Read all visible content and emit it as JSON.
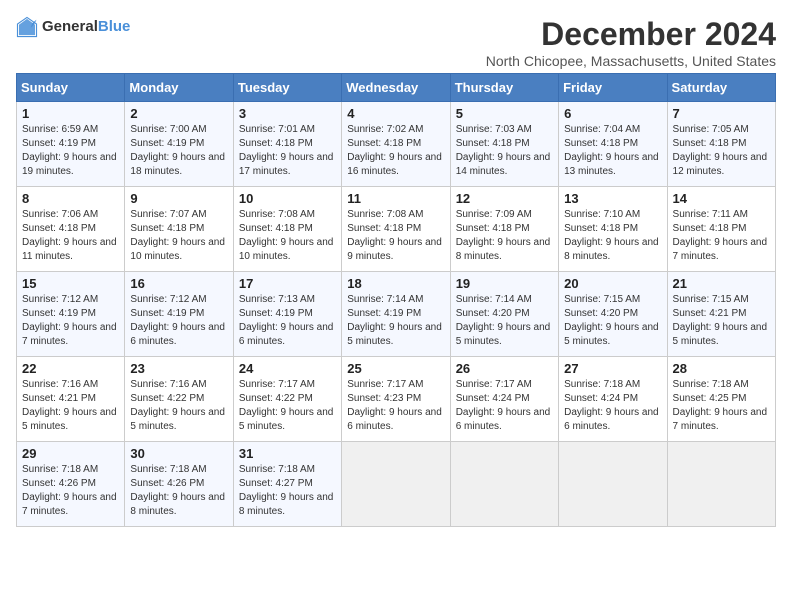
{
  "header": {
    "logo_general": "General",
    "logo_blue": "Blue",
    "title": "December 2024",
    "location": "North Chicopee, Massachusetts, United States"
  },
  "days_of_week": [
    "Sunday",
    "Monday",
    "Tuesday",
    "Wednesday",
    "Thursday",
    "Friday",
    "Saturday"
  ],
  "weeks": [
    [
      {
        "day": "1",
        "sunrise": "6:59 AM",
        "sunset": "4:19 PM",
        "daylight": "9 hours and 19 minutes."
      },
      {
        "day": "2",
        "sunrise": "7:00 AM",
        "sunset": "4:19 PM",
        "daylight": "9 hours and 18 minutes."
      },
      {
        "day": "3",
        "sunrise": "7:01 AM",
        "sunset": "4:18 PM",
        "daylight": "9 hours and 17 minutes."
      },
      {
        "day": "4",
        "sunrise": "7:02 AM",
        "sunset": "4:18 PM",
        "daylight": "9 hours and 16 minutes."
      },
      {
        "day": "5",
        "sunrise": "7:03 AM",
        "sunset": "4:18 PM",
        "daylight": "9 hours and 14 minutes."
      },
      {
        "day": "6",
        "sunrise": "7:04 AM",
        "sunset": "4:18 PM",
        "daylight": "9 hours and 13 minutes."
      },
      {
        "day": "7",
        "sunrise": "7:05 AM",
        "sunset": "4:18 PM",
        "daylight": "9 hours and 12 minutes."
      }
    ],
    [
      {
        "day": "8",
        "sunrise": "7:06 AM",
        "sunset": "4:18 PM",
        "daylight": "9 hours and 11 minutes."
      },
      {
        "day": "9",
        "sunrise": "7:07 AM",
        "sunset": "4:18 PM",
        "daylight": "9 hours and 10 minutes."
      },
      {
        "day": "10",
        "sunrise": "7:08 AM",
        "sunset": "4:18 PM",
        "daylight": "9 hours and 10 minutes."
      },
      {
        "day": "11",
        "sunrise": "7:08 AM",
        "sunset": "4:18 PM",
        "daylight": "9 hours and 9 minutes."
      },
      {
        "day": "12",
        "sunrise": "7:09 AM",
        "sunset": "4:18 PM",
        "daylight": "9 hours and 8 minutes."
      },
      {
        "day": "13",
        "sunrise": "7:10 AM",
        "sunset": "4:18 PM",
        "daylight": "9 hours and 8 minutes."
      },
      {
        "day": "14",
        "sunrise": "7:11 AM",
        "sunset": "4:18 PM",
        "daylight": "9 hours and 7 minutes."
      }
    ],
    [
      {
        "day": "15",
        "sunrise": "7:12 AM",
        "sunset": "4:19 PM",
        "daylight": "9 hours and 7 minutes."
      },
      {
        "day": "16",
        "sunrise": "7:12 AM",
        "sunset": "4:19 PM",
        "daylight": "9 hours and 6 minutes."
      },
      {
        "day": "17",
        "sunrise": "7:13 AM",
        "sunset": "4:19 PM",
        "daylight": "9 hours and 6 minutes."
      },
      {
        "day": "18",
        "sunrise": "7:14 AM",
        "sunset": "4:19 PM",
        "daylight": "9 hours and 5 minutes."
      },
      {
        "day": "19",
        "sunrise": "7:14 AM",
        "sunset": "4:20 PM",
        "daylight": "9 hours and 5 minutes."
      },
      {
        "day": "20",
        "sunrise": "7:15 AM",
        "sunset": "4:20 PM",
        "daylight": "9 hours and 5 minutes."
      },
      {
        "day": "21",
        "sunrise": "7:15 AM",
        "sunset": "4:21 PM",
        "daylight": "9 hours and 5 minutes."
      }
    ],
    [
      {
        "day": "22",
        "sunrise": "7:16 AM",
        "sunset": "4:21 PM",
        "daylight": "9 hours and 5 minutes."
      },
      {
        "day": "23",
        "sunrise": "7:16 AM",
        "sunset": "4:22 PM",
        "daylight": "9 hours and 5 minutes."
      },
      {
        "day": "24",
        "sunrise": "7:17 AM",
        "sunset": "4:22 PM",
        "daylight": "9 hours and 5 minutes."
      },
      {
        "day": "25",
        "sunrise": "7:17 AM",
        "sunset": "4:23 PM",
        "daylight": "9 hours and 6 minutes."
      },
      {
        "day": "26",
        "sunrise": "7:17 AM",
        "sunset": "4:24 PM",
        "daylight": "9 hours and 6 minutes."
      },
      {
        "day": "27",
        "sunrise": "7:18 AM",
        "sunset": "4:24 PM",
        "daylight": "9 hours and 6 minutes."
      },
      {
        "day": "28",
        "sunrise": "7:18 AM",
        "sunset": "4:25 PM",
        "daylight": "9 hours and 7 minutes."
      }
    ],
    [
      {
        "day": "29",
        "sunrise": "7:18 AM",
        "sunset": "4:26 PM",
        "daylight": "9 hours and 7 minutes."
      },
      {
        "day": "30",
        "sunrise": "7:18 AM",
        "sunset": "4:26 PM",
        "daylight": "9 hours and 8 minutes."
      },
      {
        "day": "31",
        "sunrise": "7:18 AM",
        "sunset": "4:27 PM",
        "daylight": "9 hours and 8 minutes."
      },
      null,
      null,
      null,
      null
    ]
  ],
  "labels": {
    "sunrise": "Sunrise:",
    "sunset": "Sunset:",
    "daylight": "Daylight:"
  }
}
